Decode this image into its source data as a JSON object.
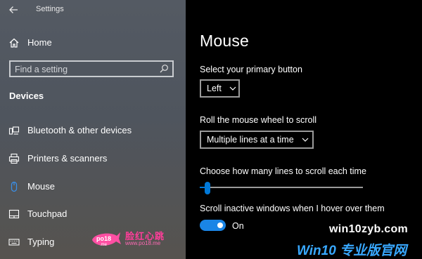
{
  "app": {
    "title": "Settings"
  },
  "sidebar": {
    "home_label": "Home",
    "search": {
      "placeholder": "Find a setting"
    },
    "section_title": "Devices",
    "items": [
      {
        "label": "Bluetooth & other devices",
        "icon": "bluetooth-devices-icon"
      },
      {
        "label": "Printers & scanners",
        "icon": "printer-icon"
      },
      {
        "label": "Mouse",
        "icon": "mouse-icon",
        "selected": true
      },
      {
        "label": "Touchpad",
        "icon": "touchpad-icon"
      },
      {
        "label": "Typing",
        "icon": "keyboard-icon"
      }
    ]
  },
  "main": {
    "title": "Mouse",
    "primary_button": {
      "label": "Select your primary button",
      "value": "Left"
    },
    "scroll_mode": {
      "label": "Roll the mouse wheel to scroll",
      "value": "Multiple lines at a time"
    },
    "scroll_lines": {
      "label": "Choose how many lines to scroll each time",
      "fraction": 0.03
    },
    "inactive_scroll": {
      "label": "Scroll inactive windows when I hover over them",
      "state": "On"
    }
  },
  "watermarks": {
    "left_logo": "po18",
    "left_logo_sub": ".me",
    "left_title": "脸红心跳",
    "left_url": "www.po18.me",
    "site": "win10zyb.com",
    "brand": "Win10 专业版官网"
  },
  "colors": {
    "accent": "#0078d7",
    "toggle_on": "#1a85e6",
    "sidebar_bg": "#545a63",
    "content_bg": "#000000",
    "watermark_pink": "#ff3d9a",
    "watermark_blue": "#38a8ff"
  }
}
